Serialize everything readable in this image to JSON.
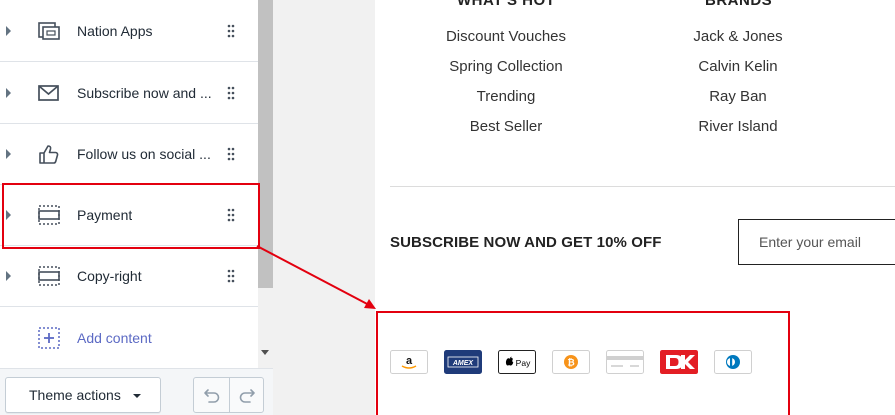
{
  "sidebar": {
    "sections": [
      {
        "label": "Nation Apps",
        "icon": "app-window-icon"
      },
      {
        "label": "Subscribe now and ...",
        "icon": "envelope-icon"
      },
      {
        "label": "Follow us on social ...",
        "icon": "thumbs-up-icon"
      },
      {
        "label": "Payment",
        "icon": "section-dashed-icon"
      },
      {
        "label": "Copy-right",
        "icon": "section-dashed-icon"
      }
    ],
    "add_content": {
      "label": "Add content",
      "icon": "add-block-icon"
    },
    "theme_actions_label": "Theme actions"
  },
  "preview": {
    "columns": [
      {
        "heading": "WHAT'S HOT",
        "links": [
          "Discount Vouches",
          "Spring Collection",
          "Trending",
          "Best Seller"
        ]
      },
      {
        "heading": "BRANDS",
        "links": [
          "Jack & Jones",
          "Calvin Kelin",
          "Ray Ban",
          "River Island"
        ]
      }
    ],
    "subscribe_title": "SUBSCRIBE NOW AND GET 10% OFF",
    "email_placeholder": "Enter your email",
    "payment_icons": [
      "amazon-pay-icon",
      "amex-icon",
      "apple-pay-icon",
      "bitcoin-icon",
      "generic-card-icon",
      "dankort-icon",
      "diners-club-icon"
    ]
  },
  "colors": {
    "accent": "#5c6ac4",
    "highlight": "#e3000f",
    "amex": "#1f3b7a",
    "dankort": "#e31e24",
    "bitcoin": "#f7931a"
  }
}
